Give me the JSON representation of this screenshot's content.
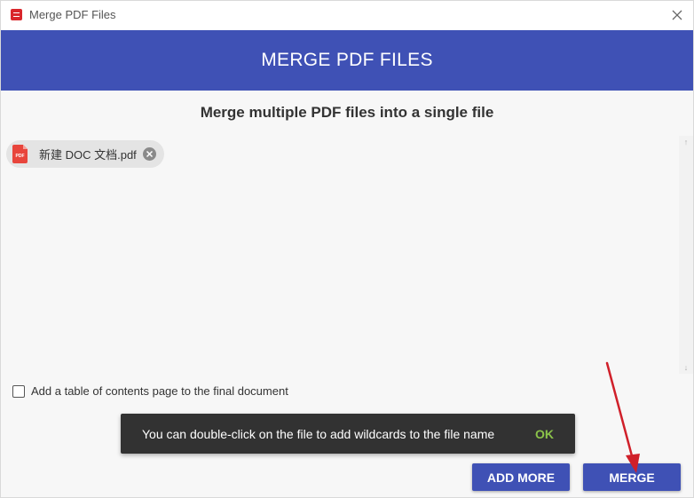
{
  "window": {
    "title": "Merge PDF Files",
    "close_symbol": "✕"
  },
  "header": {
    "title": "MERGE PDF FILES"
  },
  "main": {
    "subtitle": "Merge multiple PDF files into a single file",
    "files": [
      {
        "name": "新建 DOC 文档.pdf",
        "icon": "pdf-file-icon"
      }
    ],
    "scroll_up_symbol": "↑",
    "scroll_down_symbol": "↓"
  },
  "options": {
    "toc_label": "Add a table of contents page to the final document",
    "toc_checked": false
  },
  "snackbar": {
    "message": "You can double-click on the file to add wildcards to the file name",
    "action": "OK"
  },
  "buttons": {
    "add_more": "ADD MORE",
    "merge": "MERGE"
  },
  "colors": {
    "accent": "#3f51b5",
    "snackbar_bg": "#323232",
    "snackbar_action": "#8bc34a",
    "pdf_red": "#e8453c",
    "annotation_arrow": "#d0202a"
  }
}
